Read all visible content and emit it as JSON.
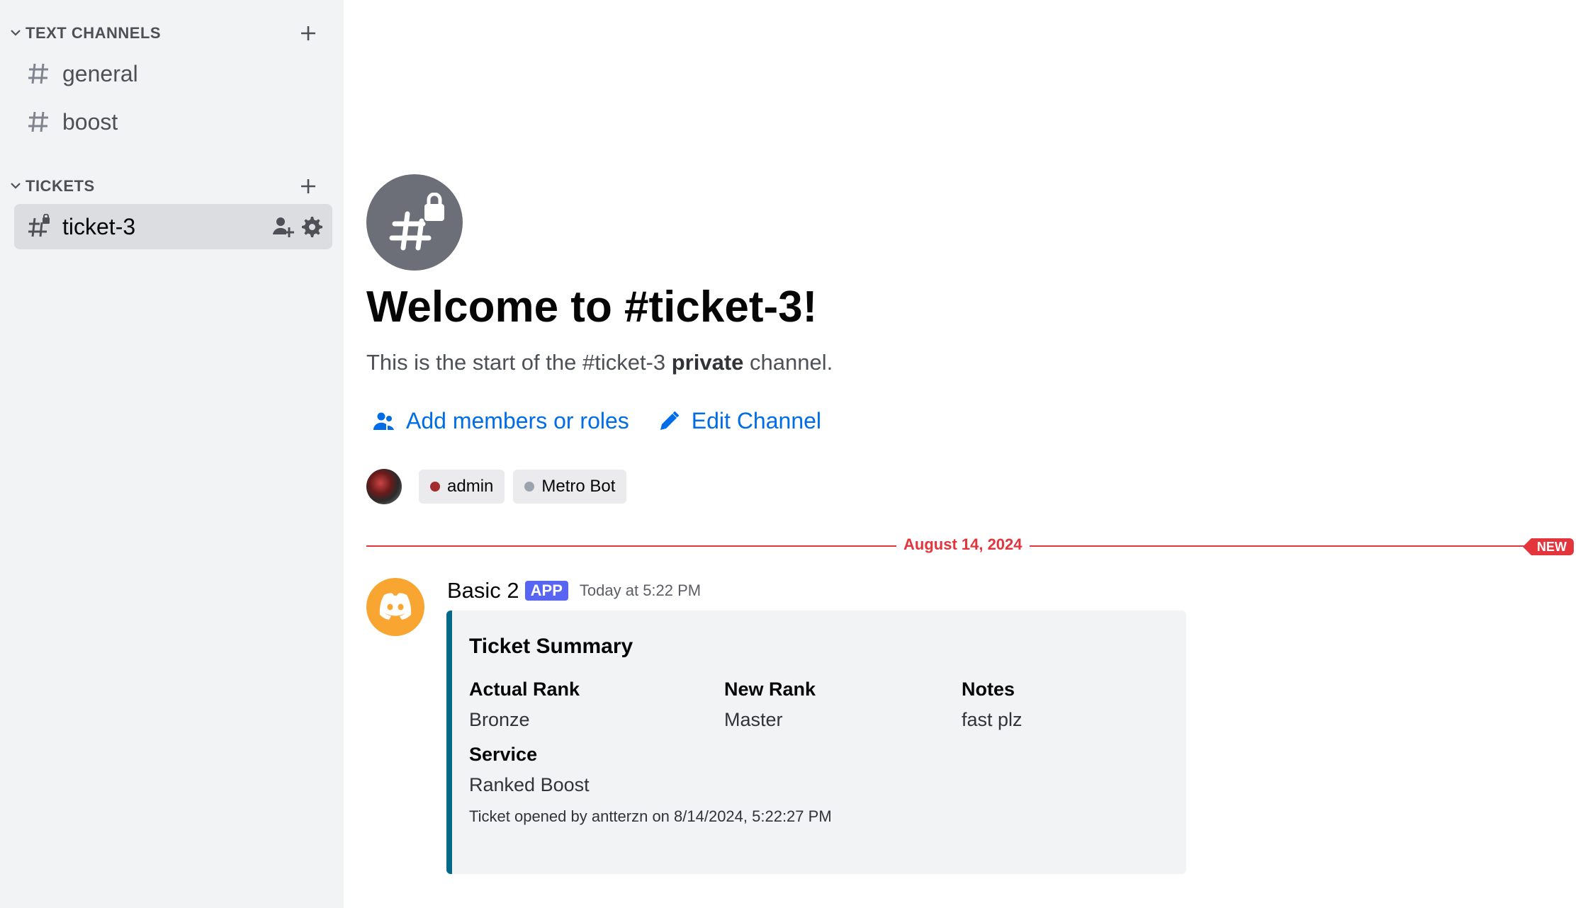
{
  "sidebar": {
    "categories": [
      {
        "label": "TEXT CHANNELS",
        "channels": [
          {
            "label": "general"
          },
          {
            "label": "boost"
          }
        ]
      },
      {
        "label": "TICKETS",
        "channels": [
          {
            "label": "ticket-3"
          }
        ]
      }
    ]
  },
  "main": {
    "welcome_title": "Welcome to #ticket-3!",
    "welcome_sub_pre": "This is the start of the #ticket-3 ",
    "welcome_sub_bold": "private",
    "welcome_sub_post": " channel.",
    "actions": {
      "add_members": "Add members or roles",
      "edit_channel": "Edit Channel"
    },
    "members": [
      {
        "name": "admin",
        "color": "#a12d2f"
      },
      {
        "name": "Metro Bot",
        "color": "#9ba4ae"
      }
    ],
    "divider_date": "August 14, 2024",
    "new_badge": "NEW",
    "message": {
      "author": "Basic 2",
      "tag": "APP",
      "time": "Today at 5:22 PM",
      "embed": {
        "title": "Ticket Summary",
        "fields": [
          {
            "name": "Actual Rank",
            "value": "Bronze"
          },
          {
            "name": "New Rank",
            "value": "Master"
          },
          {
            "name": "Notes",
            "value": "fast plz"
          },
          {
            "name": "Service",
            "value": "Ranked Boost"
          }
        ],
        "footer": "Ticket opened by antterzn on 8/14/2024, 5:22:27 PM",
        "accent_color": "#036a8a"
      }
    }
  },
  "colors": {
    "link": "#006ce7",
    "new": "#e4343c",
    "app_tag": "#5865f2",
    "bot_avatar": "#f8a532"
  }
}
